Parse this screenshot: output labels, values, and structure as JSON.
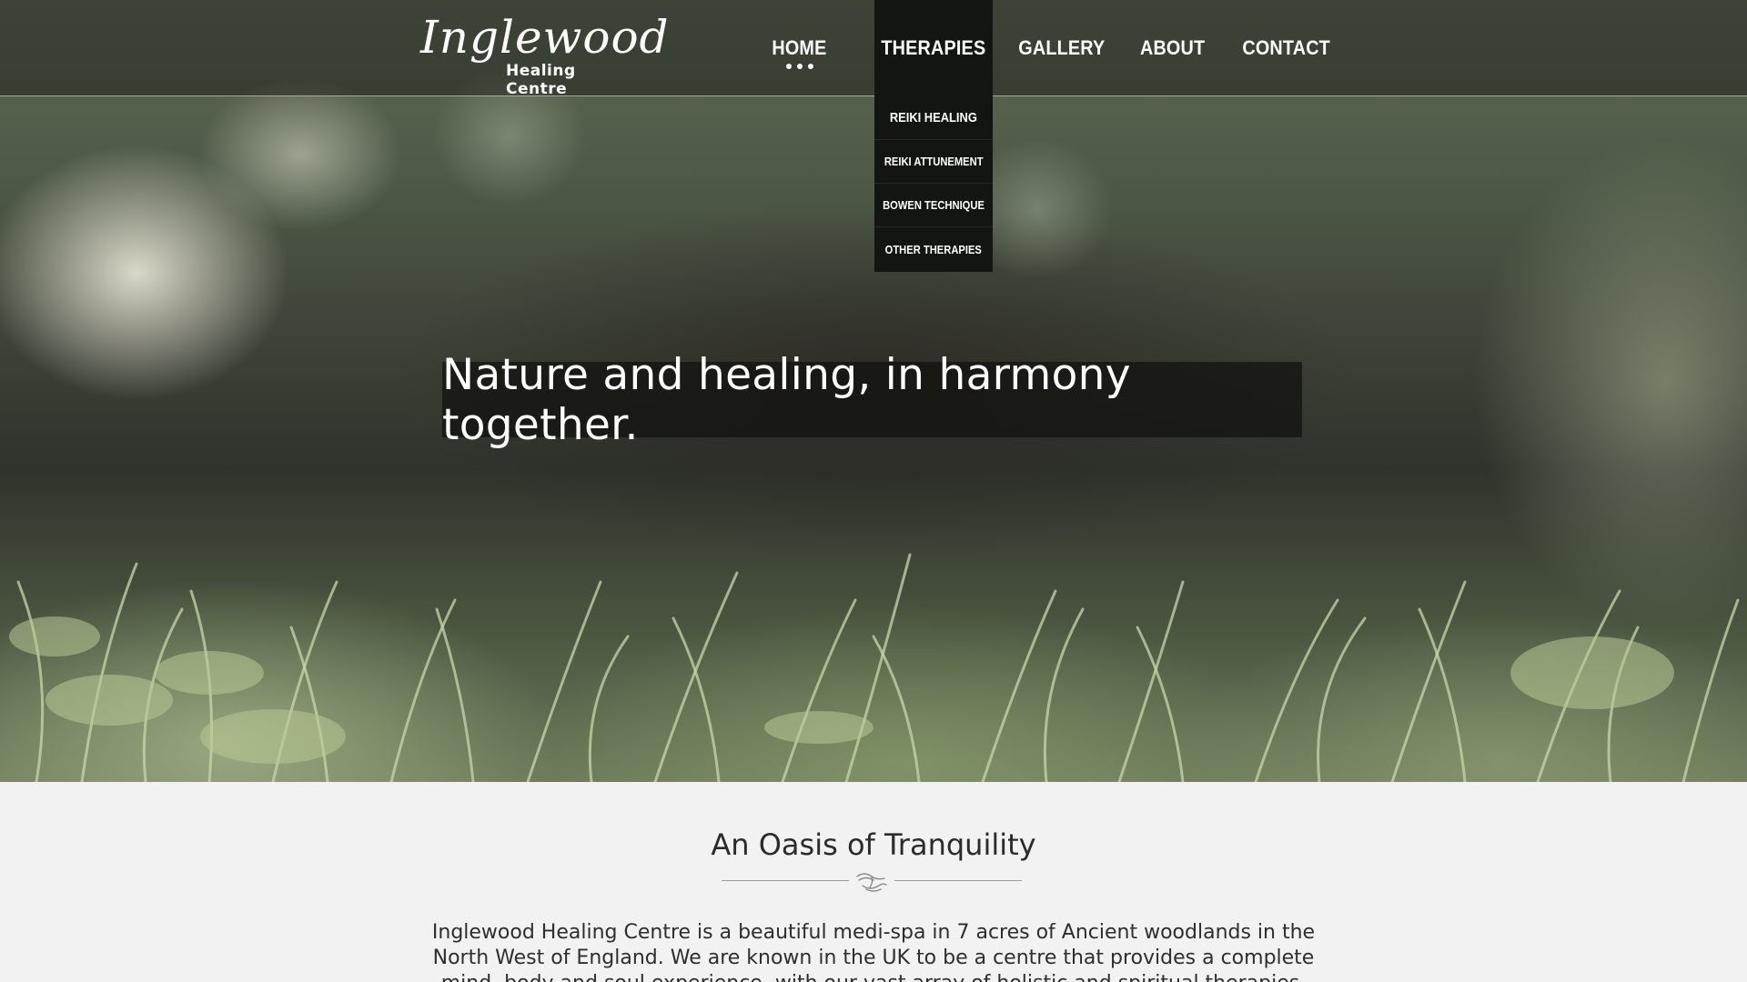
{
  "logo": {
    "main": "Inglewood",
    "sub": "Healing Centre"
  },
  "nav": {
    "home": "HOME",
    "therapies": "THERAPIES",
    "gallery": "GALLERY",
    "about": "ABOUT",
    "contact": "CONTACT"
  },
  "therapies_menu": [
    {
      "label": "REIKI HEALING"
    },
    {
      "label": "REIKI ATTUNEMENT"
    },
    {
      "label": "BOWEN TECHNIQUE"
    },
    {
      "label": "OTHER THERAPIES"
    }
  ],
  "hero": {
    "tagline": "Nature and healing, in harmony together."
  },
  "section": {
    "title": "An Oasis of Tranquility",
    "intro": "Inglewood Healing Centre is a beautiful medi-spa in 7 acres of Ancient woodlands in the North West of England. We are known in the UK to be a centre that provides a complete mind, body and soul experience, with our vast array of holistic and spiritual therapies."
  },
  "colors": {
    "header_bg": "#1b1e18",
    "dropdown_bg": "#121511",
    "content_bg": "#f2f2f2",
    "text_dark": "#2b2b2b"
  },
  "icons": {
    "divider": "hands-ornament-icon"
  }
}
